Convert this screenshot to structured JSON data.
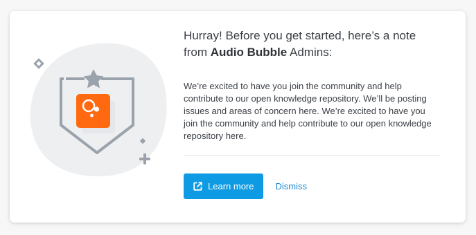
{
  "notice": {
    "headline_prefix": "Hurray! Before you get started, here’s a note from ",
    "community_name": "Audio Bubble",
    "headline_suffix": " Admins:",
    "message": "We’re excited to have you join the community and help contribute to our open knowledge repository. We’ll be posting issues and areas of concern here. We’re excited to have you join the community and help contribute to our open knowledge repository here.",
    "learn_more_label": "Learn more",
    "learn_more_icon": "external-link-icon",
    "dismiss_label": "Dismiss"
  },
  "illustration": {
    "icons": [
      "badge-shield-icon",
      "star-icon",
      "community-logo-icon",
      "diamond-icon",
      "plus-icon"
    ]
  },
  "colors": {
    "accent": "#0e9be3",
    "link": "#1c8ad1",
    "logo": "#ff6a10",
    "illustration_stroke": "#9aa3ab",
    "blob": "#eeeff1"
  }
}
